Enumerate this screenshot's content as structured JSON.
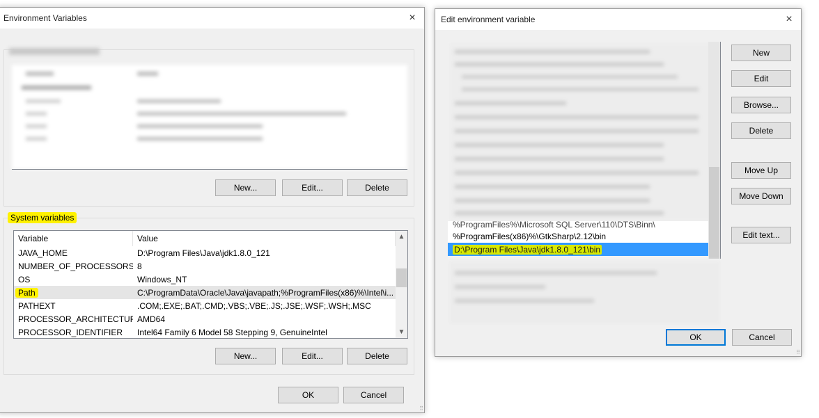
{
  "env_dialog": {
    "title": "Environment Variables",
    "user_section": {
      "label": "User variables (blurred)",
      "buttons": {
        "new": "New...",
        "edit": "Edit...",
        "delete": "Delete"
      }
    },
    "system_section": {
      "label": "System variables",
      "columns": [
        "Variable",
        "Value"
      ],
      "rows": [
        {
          "variable": "JAVA_HOME",
          "value": "D:\\Program Files\\Java\\jdk1.8.0_121"
        },
        {
          "variable": "NUMBER_OF_PROCESSORS",
          "value": "8"
        },
        {
          "variable": "OS",
          "value": "Windows_NT"
        },
        {
          "variable": "Path",
          "value": "C:\\ProgramData\\Oracle\\Java\\javapath;%ProgramFiles(x86)%\\Intel\\i..."
        },
        {
          "variable": "PATHEXT",
          "value": ".COM;.EXE;.BAT;.CMD;.VBS;.VBE;.JS;.JSE;.WSF;.WSH;.MSC"
        },
        {
          "variable": "PROCESSOR_ARCHITECTURE",
          "value": "AMD64"
        },
        {
          "variable": "PROCESSOR_IDENTIFIER",
          "value": "Intel64 Family 6 Model 58 Stepping 9, GenuineIntel"
        }
      ],
      "selected_index": 3,
      "buttons": {
        "new": "New...",
        "edit": "Edit...",
        "delete": "Delete"
      }
    },
    "ok": "OK",
    "cancel": "Cancel"
  },
  "edit_dialog": {
    "title": "Edit environment variable",
    "entries_visible": [
      "%ProgramFiles%\\Microsoft SQL Server\\110\\DTS\\Binn\\",
      "%ProgramFiles(x86)%\\GtkSharp\\2.12\\bin",
      "D:\\Program Files\\Java\\jdk1.8.0_121\\bin"
    ],
    "selected_entry": "D:\\Program Files\\Java\\jdk1.8.0_121\\bin",
    "buttons": {
      "new": "New",
      "edit": "Edit",
      "browse": "Browse...",
      "delete": "Delete",
      "move_up": "Move Up",
      "move_down": "Move Down",
      "edit_text": "Edit text..."
    },
    "ok": "OK",
    "cancel": "Cancel"
  },
  "icons": {
    "close": "×"
  }
}
